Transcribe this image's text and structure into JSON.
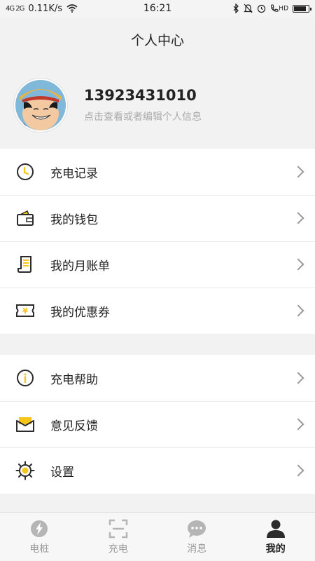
{
  "status_bar": {
    "network": "4G 2G",
    "speed": "0.11K/s",
    "time": "16:21",
    "hd_label": "HD"
  },
  "header": {
    "title": "个人中心"
  },
  "profile": {
    "phone": "13923431010",
    "hint": "点击查看或者编辑个人信息"
  },
  "menu_group_1": [
    {
      "label": "充电记录",
      "icon": "clock-icon"
    },
    {
      "label": "我的钱包",
      "icon": "wallet-icon"
    },
    {
      "label": "我的月账单",
      "icon": "bill-icon"
    },
    {
      "label": "我的优惠券",
      "icon": "coupon-icon"
    }
  ],
  "menu_group_2": [
    {
      "label": "充电帮助",
      "icon": "info-icon"
    },
    {
      "label": "意见反馈",
      "icon": "feedback-mail-icon"
    },
    {
      "label": "设置",
      "icon": "settings-gear-icon"
    }
  ],
  "tabs": [
    {
      "label": "电桩",
      "icon": "charging-pile-icon",
      "active": false
    },
    {
      "label": "充电",
      "icon": "scan-icon",
      "active": false
    },
    {
      "label": "消息",
      "icon": "message-icon",
      "active": false
    },
    {
      "label": "我的",
      "icon": "person-icon",
      "active": true
    }
  ],
  "colors": {
    "accent": "#f5c518",
    "icon_dark": "#2b2b2b",
    "tab_inactive": "#b5b5b5"
  }
}
